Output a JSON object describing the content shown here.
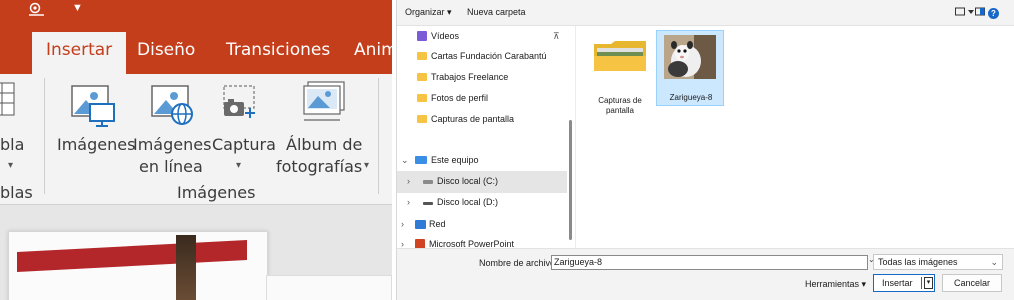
{
  "powerpoint": {
    "tabs": [
      {
        "label": "Insertar",
        "active": true
      },
      {
        "label": "Diseño",
        "active": false
      },
      {
        "label": "Transiciones",
        "active": false
      },
      {
        "label": "Anim",
        "active": false
      }
    ],
    "ribbon": {
      "partial_left_top": "bla",
      "partial_left_bottom": "blas",
      "buttons": [
        {
          "line1": "Imágenes",
          "line2": "",
          "icon": "picture-monitor-icon",
          "has_caret": false
        },
        {
          "line1": "Imágenes",
          "line2": "en línea",
          "icon": "online-pictures-icon",
          "has_caret": false
        },
        {
          "line1": "Captura",
          "line2": "",
          "icon": "screenshot-icon",
          "has_caret": true
        },
        {
          "line1": "Álbum de",
          "line2": "fotografías",
          "icon": "photo-album-icon",
          "has_caret": true
        }
      ],
      "group_label": "Imágenes"
    },
    "accent_color": "#c43e1c"
  },
  "dialog": {
    "toolbar": {
      "organize_label": "Organizar ▾",
      "new_folder_label": "Nueva carpeta"
    },
    "nav": [
      {
        "label": "Vídeos",
        "icon": "videos-icon",
        "pinned": true
      },
      {
        "label": "Cartas Fundación Carabantú",
        "icon": "folder-icon"
      },
      {
        "label": "Trabajos Freelance",
        "icon": "folder-icon"
      },
      {
        "label": "Fotos de perfil",
        "icon": "folder-icon"
      },
      {
        "label": "Capturas de pantalla",
        "icon": "folder-icon"
      },
      {
        "label": "Este equipo",
        "icon": "this-pc-icon",
        "expanded": true
      },
      {
        "label": "Disco local (C:)",
        "icon": "drive-c-icon",
        "selected": true
      },
      {
        "label": "Disco local (D:)",
        "icon": "drive-d-icon"
      },
      {
        "label": "Red",
        "icon": "network-icon"
      },
      {
        "label": "Microsoft PowerPoint",
        "icon": "powerpoint-icon"
      }
    ],
    "files": [
      {
        "name": "Capturas de pantalla",
        "type": "folder",
        "selected": false
      },
      {
        "name": "Zarigueya-8",
        "type": "image",
        "selected": true
      }
    ],
    "file_name_label": "Nombre de archivo:",
    "file_name_value": "Zarigueya-8",
    "file_type_value": "Todas las imágenes",
    "tools_label": "Herramientas ▾",
    "insert_label": "Insertar",
    "cancel_label": "Cancelar",
    "accent_color": "#1668c9",
    "selection_color": "#cce8ff"
  }
}
